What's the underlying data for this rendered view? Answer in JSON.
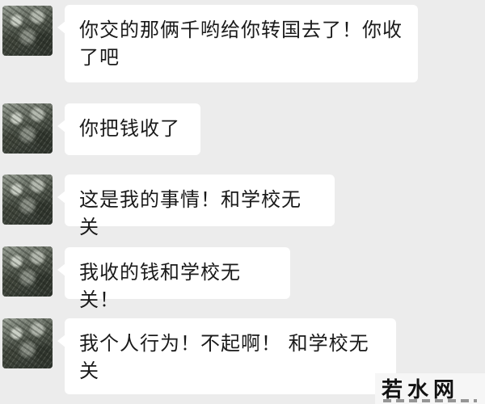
{
  "messages": [
    {
      "text": "你交的那俩千哟给你转国去了！你收了吧"
    },
    {
      "text": "你把钱收了"
    },
    {
      "text": "这是我的事情！和学校无关"
    },
    {
      "text": "我收的钱和学校无关！"
    },
    {
      "text": "我个人行为！不起啊！ 和学校无关"
    }
  ],
  "watermark": {
    "text": "若水网"
  }
}
